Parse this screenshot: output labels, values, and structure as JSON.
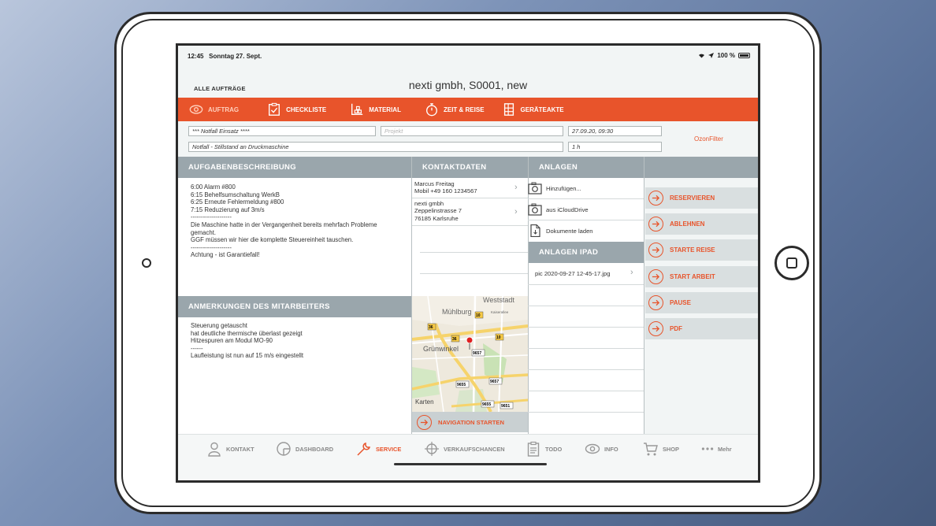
{
  "status": {
    "time": "12:45",
    "date": "Sonntag 27. Sept.",
    "battery": "100 %"
  },
  "nav": {
    "back": "ALLE AUFTRÄGE",
    "title": "nexti gmbh, S0001, new"
  },
  "tabs": [
    {
      "label": "AUFTRAG",
      "icon": "eye-icon",
      "active": true
    },
    {
      "label": "CHECKLISTE",
      "icon": "checklist-icon"
    },
    {
      "label": "MATERIAL",
      "icon": "material-icon"
    },
    {
      "label": "ZEIT & REISE",
      "icon": "stopwatch-icon"
    },
    {
      "label": "GERÄTEAKTE",
      "icon": "device-file-icon"
    }
  ],
  "fields": {
    "title": "*** Notfall Einsatz ****",
    "project_placeholder": "Projekt",
    "datetime": "27.09.20, 09:30",
    "subject": "Notfall - Stillstand an Druckmaschine",
    "duration": "1 h",
    "filter": "OzonFilter"
  },
  "sections": {
    "task_heading": "AUFGABENBESCHREIBUNG",
    "task_text": "6:00 Alarm #800\n6:15 Behelfsumschaltung WerkB\n6:25 Erneute Fehlermeldung #800\n7:15 Reduzierung auf 3m/s\n--------------------\nDie Maschine hatte in der Vergangenheit bereits mehrfach Probleme\ngemacht.\nGGF müssen wir hier die komplette Steuereinheit tauschen.\n--------------------\nAchtung - ist Garantiefall!",
    "notes_heading": "ANMERKUNGEN DES MITARBEITERS",
    "notes_text": "Steuerung getauscht\nhat deutliche thermische überlast gezeigt\nHitzespuren am Modul MO-90\n------\nLaufleistung ist nun auf 15 m/s eingestellt",
    "contact_heading": "KONTAKTDATEN",
    "attach_heading": "ANLAGEN",
    "ipad_heading": "ANLAGEN IPAD"
  },
  "contacts": [
    {
      "line1": "Marcus Freitag",
      "line2": "Mobil +49 160 1234567"
    },
    {
      "line1": "nexti gmbh",
      "line2": "Zeppelinstrasse 7",
      "line3": "76185 Karlsruhe"
    }
  ],
  "attachments": [
    "Hinzufügen...",
    "aus iCloudDrive",
    "Dokumente laden"
  ],
  "ipad_files": [
    "pic 2020-09-27 12-45-17.jpg"
  ],
  "map": {
    "labels": [
      "Mühlburg",
      "Weststadt",
      "Grünwinkel",
      "Kaiserallee"
    ],
    "road_numbers": [
      "36",
      "10",
      "36",
      "10",
      "9657",
      "9657",
      "9655",
      "9655",
      "9651"
    ],
    "attribution": "Karten"
  },
  "navigation_button": "NAVIGATION STARTEN",
  "actions": [
    "RESERVIEREN",
    "ABLEHNEN",
    "STARTE REISE",
    "START ARBEIT",
    "PAUSE",
    "PDF"
  ],
  "bottom_tabs": [
    {
      "label": "KONTAKT",
      "icon": "person-icon"
    },
    {
      "label": "DASHBOARD",
      "icon": "dashboard-icon"
    },
    {
      "label": "SERVICE",
      "icon": "wrench-icon",
      "active": true
    },
    {
      "label": "VERKAUFSCHANCEN",
      "icon": "target-icon"
    },
    {
      "label": "TODO",
      "icon": "clipboard-icon"
    },
    {
      "label": "INFO",
      "icon": "eye-icon"
    },
    {
      "label": "SHOP",
      "icon": "cart-icon"
    },
    {
      "label": "Mehr",
      "icon": "more-icon"
    }
  ],
  "colors": {
    "accent": "#e8542b",
    "header_gray": "#9aa6ac",
    "action_bg": "#d9dfe0"
  }
}
